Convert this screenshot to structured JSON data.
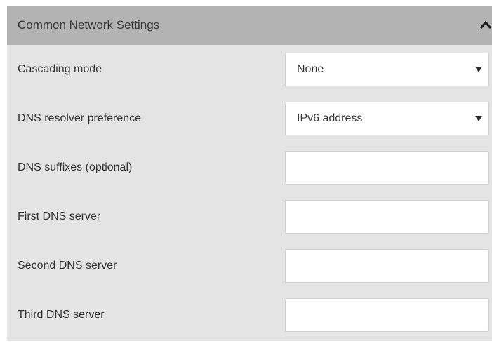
{
  "panel": {
    "title": "Common Network Settings",
    "collapse_icon": "chevron-up-icon"
  },
  "fields": {
    "cascading_mode": {
      "label": "Cascading mode",
      "value": "None",
      "icon": "dropdown-triangle-icon"
    },
    "dns_resolver_preference": {
      "label": "DNS resolver preference",
      "value": "IPv6 address",
      "icon": "dropdown-triangle-icon"
    },
    "dns_suffixes": {
      "label": "DNS suffixes (optional)",
      "value": ""
    },
    "first_dns_server": {
      "label": "First DNS server",
      "value": ""
    },
    "second_dns_server": {
      "label": "Second DNS server",
      "value": ""
    },
    "third_dns_server": {
      "label": "Third DNS server",
      "value": ""
    }
  },
  "colors": {
    "header_background": "#b3b3b3",
    "panel_background": "#e4e4e4",
    "control_background": "#ffffff",
    "text": "#333333"
  }
}
